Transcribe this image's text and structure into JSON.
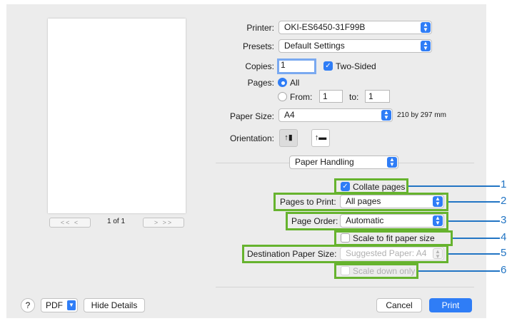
{
  "printer": {
    "label": "Printer:",
    "value": "OKI-ES6450-31F99B"
  },
  "presets": {
    "label": "Presets:",
    "value": "Default Settings"
  },
  "copies": {
    "label": "Copies:",
    "value": "1",
    "two_sided_label": "Two-Sided",
    "two_sided_checked": true
  },
  "pages": {
    "label": "Pages:",
    "all_label": "All",
    "from_label": "From:",
    "from_value": "1",
    "to_label": "to:",
    "to_value": "1",
    "selected": "all"
  },
  "paper_size": {
    "label": "Paper Size:",
    "value": "A4",
    "dimensions": "210 by 297 mm"
  },
  "orientation": {
    "label": "Orientation:",
    "selected": "portrait",
    "icons": [
      "portrait-icon",
      "landscape-icon"
    ]
  },
  "section": {
    "value": "Paper Handling"
  },
  "collate": {
    "label": "Collate pages",
    "checked": true
  },
  "pages_to_print": {
    "label": "Pages to Print:",
    "value": "All pages"
  },
  "page_order": {
    "label": "Page Order:",
    "value": "Automatic"
  },
  "scale_fit": {
    "label": "Scale to fit paper size",
    "checked": false
  },
  "destination": {
    "label": "Destination Paper Size:",
    "value": "Suggested Paper: A4",
    "disabled": true
  },
  "scale_down": {
    "label": "Scale down only",
    "checked": false,
    "disabled": true
  },
  "callouts": [
    "1",
    "2",
    "3",
    "4",
    "5",
    "6"
  ],
  "preview_nav": {
    "first": "<<",
    "prev": "<",
    "page_text": "1 of 1",
    "next": ">",
    "last": ">>"
  },
  "footer": {
    "help": "?",
    "pdf": "PDF",
    "hide_details": "Hide Details",
    "cancel": "Cancel",
    "print": "Print"
  },
  "colors": {
    "accent": "#2f7df6",
    "highlight": "#66b32e",
    "callout": "#2275c4"
  }
}
